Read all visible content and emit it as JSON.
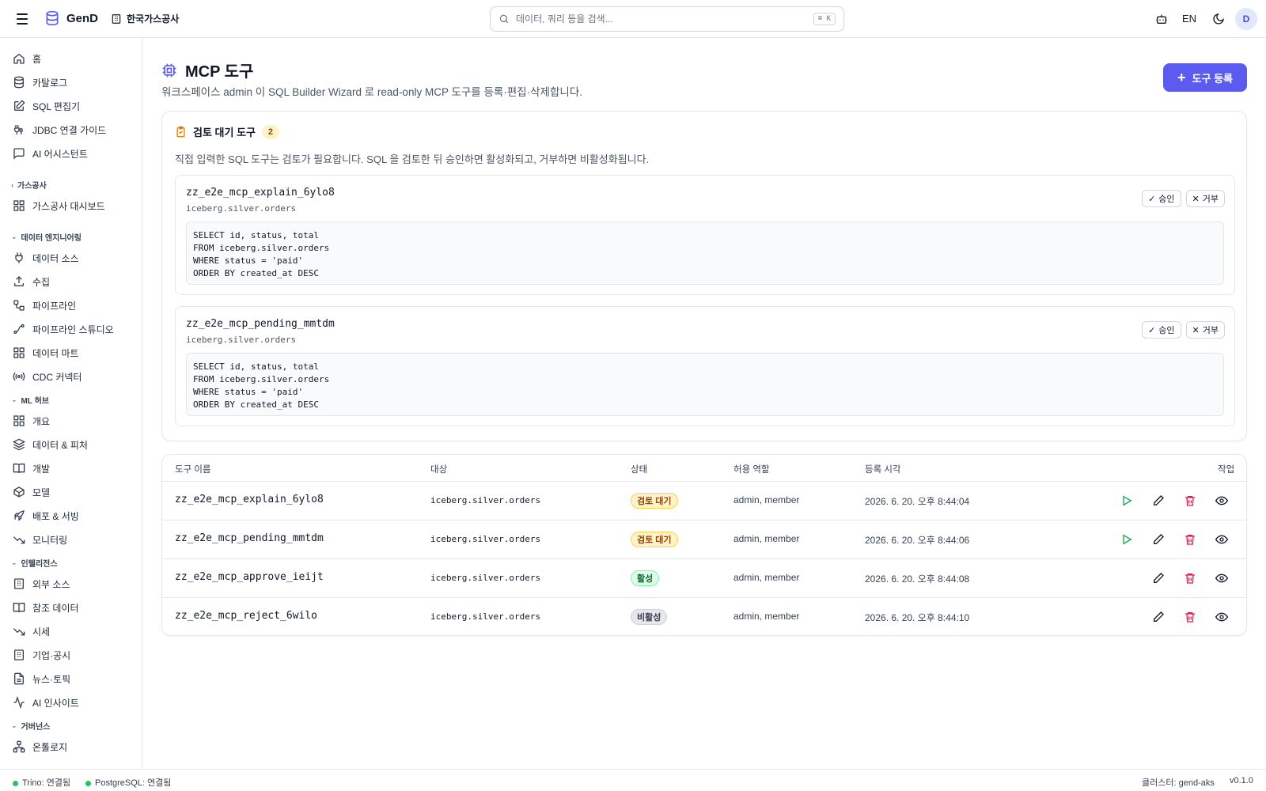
{
  "header": {
    "app_name": "GenD",
    "org_name": "한국가스공사",
    "search_placeholder": "데이터, 쿼리 등을 검색...",
    "search_shortcut": "⌘ K",
    "lang": "EN",
    "avatar_initial": "D"
  },
  "sidebar": {
    "top_items": [
      {
        "label": "홈",
        "icon": "home-icon"
      },
      {
        "label": "카탈로그",
        "icon": "database-icon"
      },
      {
        "label": "SQL 편집기",
        "icon": "edit-icon"
      },
      {
        "label": "JDBC 연결 가이드",
        "icon": "cable-icon"
      },
      {
        "label": "AI 어시스턴트",
        "icon": "chat-icon"
      }
    ],
    "sections": [
      {
        "label": "가스공사",
        "collapsed": true,
        "items": [
          {
            "label": "가스공사 대시보드",
            "icon": "grid-icon"
          }
        ]
      },
      {
        "label": "데이터 엔지니어링",
        "collapsed": false,
        "items": [
          {
            "label": "데이터 소스",
            "icon": "plug-icon"
          },
          {
            "label": "수집",
            "icon": "upload-icon"
          },
          {
            "label": "파이프라인",
            "icon": "workflow-icon"
          },
          {
            "label": "파이프라인 스튜디오",
            "icon": "flow-icon"
          },
          {
            "label": "데이터 마트",
            "icon": "grid-icon"
          },
          {
            "label": "CDC 커넥터",
            "icon": "radio-icon"
          }
        ]
      },
      {
        "label": "ML 허브",
        "collapsed": false,
        "items": [
          {
            "label": "개요",
            "icon": "grid-icon"
          },
          {
            "label": "데이터 & 피처",
            "icon": "layers-icon"
          },
          {
            "label": "개발",
            "icon": "book-icon"
          },
          {
            "label": "모델",
            "icon": "box-icon"
          },
          {
            "label": "배포 & 서빙",
            "icon": "rocket-icon"
          },
          {
            "label": "모니터링",
            "icon": "trend-down-icon"
          }
        ]
      },
      {
        "label": "인텔리전스",
        "collapsed": false,
        "items": [
          {
            "label": "외부 소스",
            "icon": "building-icon"
          },
          {
            "label": "참조 데이터",
            "icon": "book-icon"
          },
          {
            "label": "시세",
            "icon": "trend-down-icon"
          },
          {
            "label": "기업·공시",
            "icon": "building-icon"
          },
          {
            "label": "뉴스·토픽",
            "icon": "file-icon"
          },
          {
            "label": "AI 인사이트",
            "icon": "activity-icon"
          }
        ]
      },
      {
        "label": "거버넌스",
        "collapsed": false,
        "items": [
          {
            "label": "온톨로지",
            "icon": "network-icon"
          }
        ]
      }
    ]
  },
  "page": {
    "title": "MCP 도구",
    "description": "워크스페이스 admin 이 SQL Builder Wizard 로 read-only MCP 도구를 등록·편집·삭제합니다.",
    "register_label": "도구 등록"
  },
  "pending": {
    "title": "검토 대기 도구",
    "count": "2",
    "description": "직접 입력한 SQL 도구는 검토가 필요합니다. SQL 을 검토한 뒤 승인하면 활성화되고, 거부하면 비활성화됩니다.",
    "approve_label": "승인",
    "reject_label": "거부",
    "tools": [
      {
        "name": "zz_e2e_mcp_explain_6ylo8",
        "target": "iceberg.silver.orders",
        "sql": [
          "SELECT id, status, total",
          "FROM iceberg.silver.orders",
          "WHERE status = 'paid'",
          "ORDER BY created_at DESC"
        ]
      },
      {
        "name": "zz_e2e_mcp_pending_mmtdm",
        "target": "iceberg.silver.orders",
        "sql": [
          "SELECT id, status, total",
          "FROM iceberg.silver.orders",
          "WHERE status = 'paid'",
          "ORDER BY created_at DESC"
        ]
      }
    ]
  },
  "table": {
    "columns": {
      "name": "도구 이름",
      "target": "대상",
      "status": "상태",
      "roles": "허용 역할",
      "created": "등록 시각",
      "actions": "작업"
    },
    "rows": [
      {
        "name": "zz_e2e_mcp_explain_6ylo8",
        "target": "iceberg.silver.orders",
        "status": "검토 대기",
        "status_kind": "pending",
        "roles": "admin, member",
        "created": "2026. 6. 20. 오후 8:44:04",
        "can_run": true
      },
      {
        "name": "zz_e2e_mcp_pending_mmtdm",
        "target": "iceberg.silver.orders",
        "status": "검토 대기",
        "status_kind": "pending",
        "roles": "admin, member",
        "created": "2026. 6. 20. 오후 8:44:06",
        "can_run": true
      },
      {
        "name": "zz_e2e_mcp_approve_ieijt",
        "target": "iceberg.silver.orders",
        "status": "활성",
        "status_kind": "active",
        "roles": "admin, member",
        "created": "2026. 6. 20. 오후 8:44:08",
        "can_run": false
      },
      {
        "name": "zz_e2e_mcp_reject_6wilo",
        "target": "iceberg.silver.orders",
        "status": "비활성",
        "status_kind": "inactive",
        "roles": "admin, member",
        "created": "2026. 6. 20. 오후 8:44:10",
        "can_run": false
      }
    ]
  },
  "footer": {
    "trino_status": "Trino: 연결됨",
    "postgres_status": "PostgreSQL: 연결됨",
    "cluster": "클러스터: gend-aks",
    "version": "v0.1.0"
  },
  "colors": {
    "accent": "#5b5bf0",
    "success": "#22c55e",
    "danger": "#e11d48",
    "pending": "#fef3c7"
  }
}
